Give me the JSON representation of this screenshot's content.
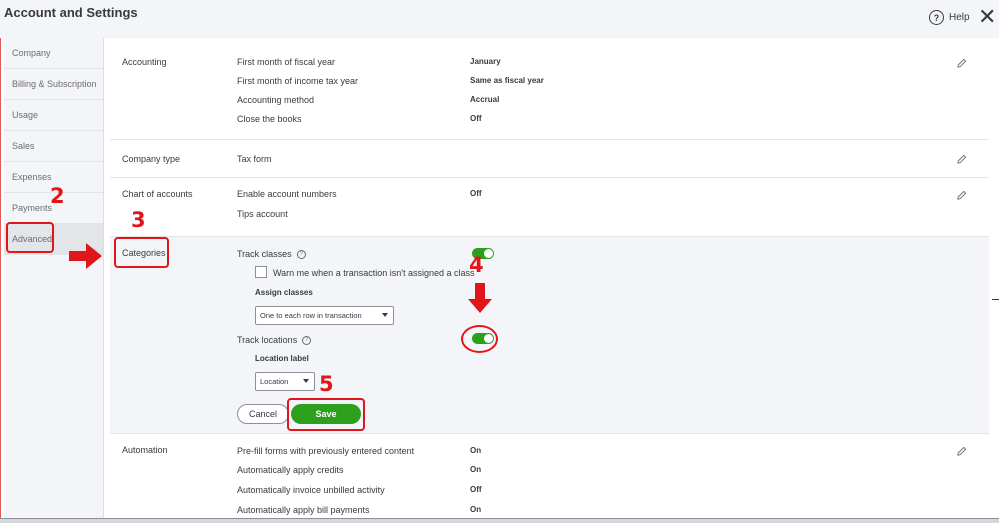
{
  "window": {
    "title": "Account and Settings",
    "help_label": "Help",
    "help_glyph": "?",
    "close_glyph": "✕"
  },
  "sidebar": {
    "items": [
      {
        "label": "Company"
      },
      {
        "label": "Billing & Subscription"
      },
      {
        "label": "Usage"
      },
      {
        "label": "Sales"
      },
      {
        "label": "Expenses"
      },
      {
        "label": "Payments"
      },
      {
        "label": "Advanced",
        "active": true
      }
    ]
  },
  "accounting": {
    "label": "Accounting",
    "rows": [
      {
        "label": "First month of fiscal year",
        "value": "January"
      },
      {
        "label": "First month of income tax year",
        "value": "Same as fiscal year"
      },
      {
        "label": "Accounting method",
        "value": "Accrual"
      },
      {
        "label": "Close the books",
        "value": "Off"
      }
    ]
  },
  "company_type": {
    "label": "Company type",
    "row_label": "Tax form"
  },
  "chart_of_accounts": {
    "label": "Chart of accounts",
    "rows": [
      {
        "label": "Enable account numbers",
        "value": "Off"
      },
      {
        "label": "Tips account",
        "value": ""
      }
    ]
  },
  "categories": {
    "label": "Categories",
    "track_classes_label": "Track classes",
    "track_classes_on": true,
    "warn_label": "Warn me when a transaction isn't assigned a class",
    "warn_checked": false,
    "assign_classes_label": "Assign classes",
    "assign_classes_value": "One to each row in transaction",
    "track_locations_label": "Track locations",
    "track_locations_on": true,
    "location_label_label": "Location label",
    "location_label_value": "Location",
    "cancel_label": "Cancel",
    "save_label": "Save"
  },
  "automation": {
    "label": "Automation",
    "rows": [
      {
        "label": "Pre-fill forms with previously entered content",
        "value": "On"
      },
      {
        "label": "Automatically apply credits",
        "value": "On"
      },
      {
        "label": "Automatically invoice unbilled activity",
        "value": "Off"
      },
      {
        "label": "Automatically apply bill payments",
        "value": "On"
      }
    ]
  },
  "annotations": {
    "step2": "2",
    "step3": "3",
    "step4": "4",
    "step5": "5",
    "color": "#e0161b"
  },
  "colors": {
    "accent_green": "#2ca01c",
    "sidebar_bg": "#f4f5f8",
    "text": "#393a3d"
  }
}
